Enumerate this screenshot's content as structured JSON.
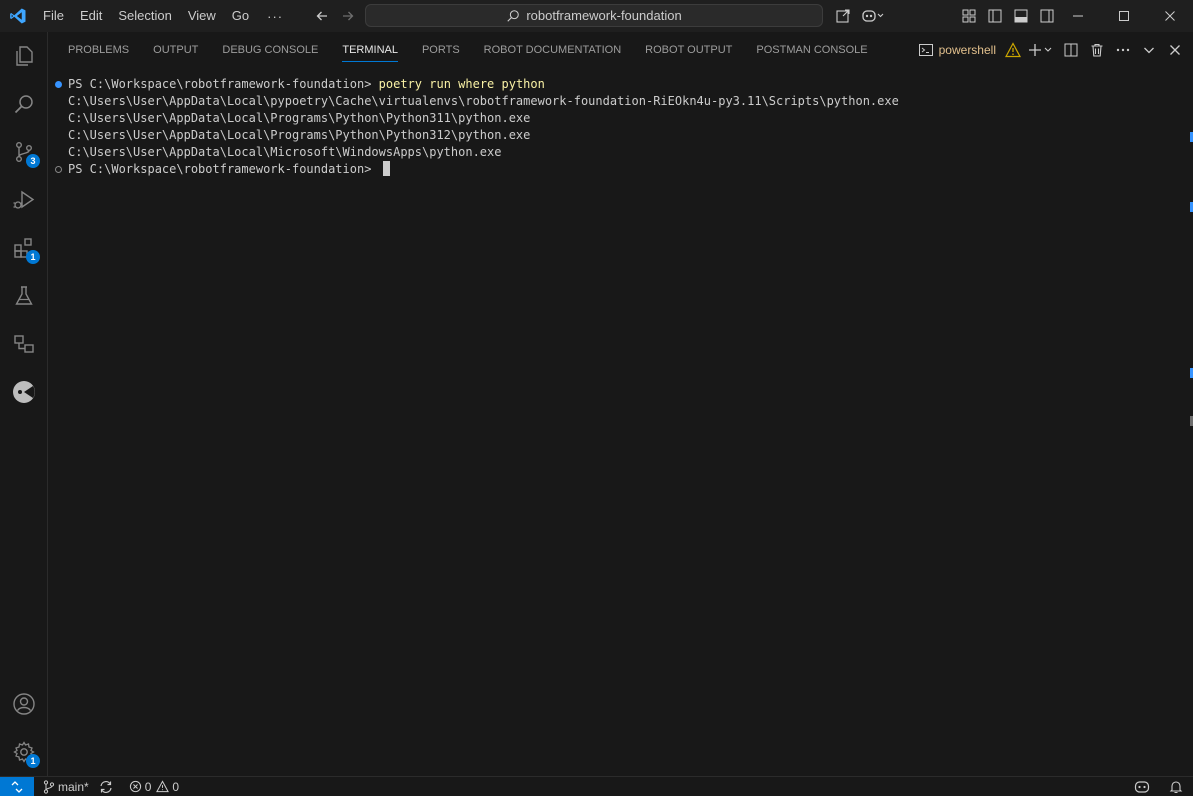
{
  "titlebar": {
    "menu": [
      "File",
      "Edit",
      "Selection",
      "View",
      "Go"
    ],
    "more": "···",
    "search_text": "robotframework-foundation"
  },
  "activity": {
    "source_control_badge": "3",
    "extensions_badge": "1",
    "settings_badge": "1"
  },
  "panel": {
    "tabs": [
      "PROBLEMS",
      "OUTPUT",
      "DEBUG CONSOLE",
      "TERMINAL",
      "PORTS",
      "ROBOT DOCUMENTATION",
      "ROBOT OUTPUT",
      "POSTMAN CONSOLE"
    ],
    "active_tab": "TERMINAL",
    "shell_name": "powershell"
  },
  "terminal": {
    "prompt1": "PS C:\\Workspace\\robotframework-foundation> ",
    "command1": "poetry run where python",
    "output": [
      "C:\\Users\\User\\AppData\\Local\\pypoetry\\Cache\\virtualenvs\\robotframework-foundation-RiEOkn4u-py3.11\\Scripts\\python.exe",
      "C:\\Users\\User\\AppData\\Local\\Programs\\Python\\Python311\\python.exe",
      "C:\\Users\\User\\AppData\\Local\\Programs\\Python\\Python312\\python.exe",
      "C:\\Users\\User\\AppData\\Local\\Microsoft\\WindowsApps\\python.exe"
    ],
    "prompt2": "PS C:\\Workspace\\robotframework-foundation> "
  },
  "statusbar": {
    "branch": "main*",
    "errors": "0",
    "warnings": "0"
  },
  "colors": {
    "accent": "#0078d4",
    "command": "#f9f1a5",
    "warning": "#cca700"
  }
}
